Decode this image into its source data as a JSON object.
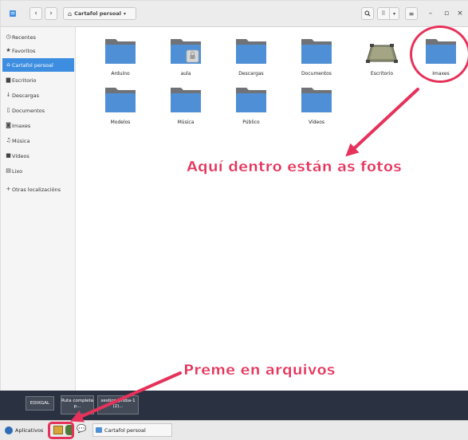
{
  "window": {
    "path_label": "Cartafol persoal",
    "controls": {
      "minimize": "–",
      "maximize": "▫",
      "close": "×"
    }
  },
  "sidebar": {
    "items": [
      {
        "label": "Recentes",
        "icon": "clock-icon"
      },
      {
        "label": "Favoritos",
        "icon": "star-icon"
      },
      {
        "label": "Cartafol persoal",
        "icon": "home-icon",
        "active": true
      },
      {
        "label": "Escritorio",
        "icon": "desktop-icon"
      },
      {
        "label": "Descargas",
        "icon": "download-icon"
      },
      {
        "label": "Documentos",
        "icon": "document-icon"
      },
      {
        "label": "Imaxes",
        "icon": "camera-icon"
      },
      {
        "label": "Música",
        "icon": "music-icon"
      },
      {
        "label": "Vídeos",
        "icon": "video-icon"
      },
      {
        "label": "Lixo",
        "icon": "trash-icon"
      },
      {
        "label": "Otras localizacións",
        "icon": "plus-icon"
      }
    ]
  },
  "folders": [
    {
      "label": "Arduino"
    },
    {
      "label": "aula"
    },
    {
      "label": "Descargas"
    },
    {
      "label": "Documentos"
    },
    {
      "label": "Escritorio"
    },
    {
      "label": "Imaxes"
    },
    {
      "label": "Modelos"
    },
    {
      "label": "Música"
    },
    {
      "label": "Público"
    },
    {
      "label": "Vídeos"
    }
  ],
  "annotations": {
    "top": "Aquí dentro están as fotos",
    "bottom": "Preme en arquivos"
  },
  "desktop": {
    "items": [
      "EDIXGAL",
      "Ruta completa p...",
      "xestion-proba-1 (2)..."
    ]
  },
  "taskbar": {
    "apps_label": "Aplicativos",
    "window_label": "Cartafol persoal"
  },
  "colors": {
    "accent": "#3d8ee0",
    "annotation": "#e6325a",
    "folder_blue": "#4f8fd6",
    "folder_gray": "#8a8a8a"
  }
}
